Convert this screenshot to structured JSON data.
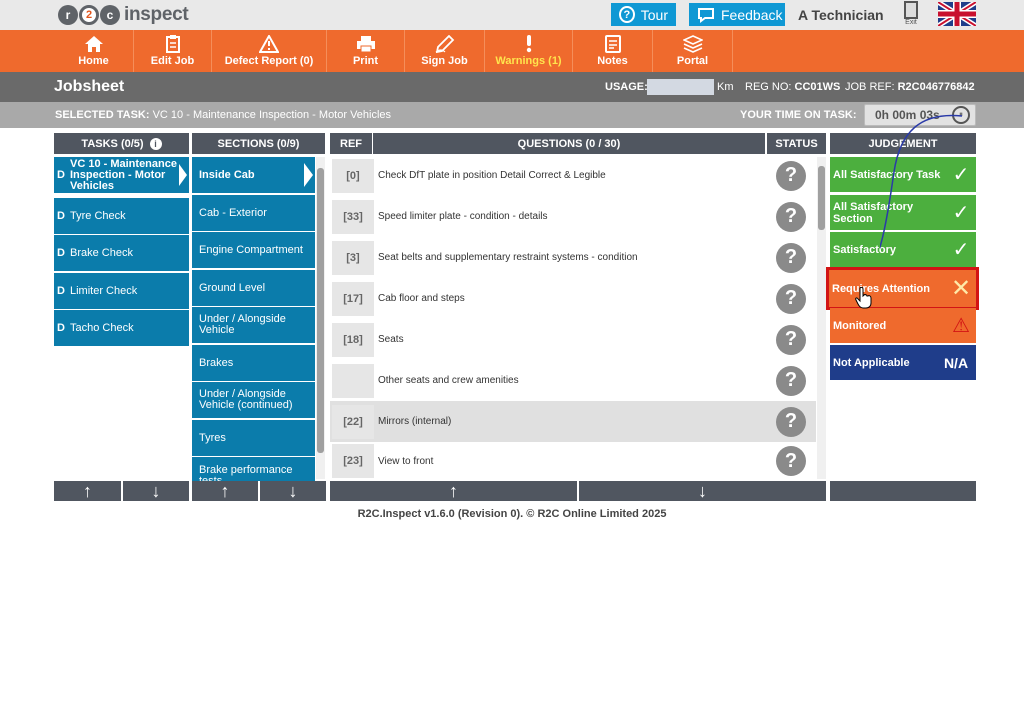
{
  "topbar": {
    "logo_text": "inspect",
    "logo_letters": [
      "r",
      "2",
      "c"
    ],
    "tour_label": "Tour",
    "feedback_label": "Feedback",
    "user_name": "A Technician",
    "exit_label": "Exit",
    "language_flag": "uk-flag-icon"
  },
  "toolbar": {
    "items": [
      {
        "label": "Home",
        "icon": "home-icon"
      },
      {
        "label": "Edit Job",
        "icon": "clipboard-icon"
      },
      {
        "label": "Defect Report (0)",
        "icon": "warning-triangle-icon"
      },
      {
        "label": "Print",
        "icon": "printer-icon"
      },
      {
        "label": "Sign Job",
        "icon": "pen-icon"
      },
      {
        "label": "Warnings (1)",
        "icon": "exclamation-icon"
      },
      {
        "label": "Notes",
        "icon": "notes-icon"
      },
      {
        "label": "Portal",
        "icon": "portal-icon"
      }
    ]
  },
  "jobsheet": {
    "title": "Jobsheet",
    "usage_label": "USAGE:",
    "usage_value": "",
    "usage_unit": "Km",
    "reg_label": "REG NO:",
    "reg_value": "CC01WS",
    "job_ref_label": "JOB REF:",
    "job_ref_value": "R2C046776842"
  },
  "selected_task": {
    "label": "SELECTED TASK:",
    "value": "VC 10 - Maintenance Inspection - Motor Vehicles",
    "time_label": "YOUR TIME ON TASK:",
    "time_value": "0h 00m 03s"
  },
  "columns": {
    "tasks": "TASKS (0/5)",
    "sections": "SECTIONS (0/9)",
    "ref": "REF",
    "questions": "QUESTIONS (0 / 30)",
    "status": "STATUS",
    "judgement": "JUDGEMENT"
  },
  "tasks": [
    {
      "prefix": "D",
      "label": "VC 10 - Maintenance Inspection - Motor Vehicles",
      "active": true
    },
    {
      "prefix": "D",
      "label": "Tyre Check"
    },
    {
      "prefix": "D",
      "label": "Brake Check"
    },
    {
      "prefix": "D",
      "label": "Limiter Check"
    },
    {
      "prefix": "D",
      "label": "Tacho Check"
    }
  ],
  "sections": [
    {
      "label": "Inside Cab",
      "active": true
    },
    {
      "label": "Cab - Exterior"
    },
    {
      "label": "Engine Compartment"
    },
    {
      "label": "Ground Level"
    },
    {
      "label": "Under / Alongside Vehicle"
    },
    {
      "label": "Brakes"
    },
    {
      "label": "Under / Alongside Vehicle (continued)"
    },
    {
      "label": "Tyres"
    },
    {
      "label": "Brake performance tests"
    }
  ],
  "questions": [
    {
      "ref": "[0]",
      "text": "Check DfT plate in position Detail Correct & Legible",
      "status": "?"
    },
    {
      "ref": "[33]",
      "text": "Speed limiter plate - condition - details",
      "status": "?"
    },
    {
      "ref": "[3]",
      "text": "Seat belts and supplementary restraint systems - condition",
      "status": "?"
    },
    {
      "ref": "[17]",
      "text": "Cab floor and steps",
      "status": "?"
    },
    {
      "ref": "[18]",
      "text": "Seats",
      "status": "?"
    },
    {
      "ref": "",
      "text": "Other seats and crew amenities",
      "status": "?"
    },
    {
      "ref": "[22]",
      "text": "Mirrors (internal)",
      "status": "?",
      "highlight": true
    },
    {
      "ref": "[23]",
      "text": "View to front",
      "status": "?"
    }
  ],
  "judgement": [
    {
      "label": "All Satisfactory Task",
      "mark": "✓",
      "color": "#4caf3e"
    },
    {
      "label": "All Satisfactory Section",
      "mark": "✓",
      "color": "#4caf3e"
    },
    {
      "label": "Satisfactory",
      "mark": "✓",
      "color": "#4caf3e"
    },
    {
      "label": "Requires Attention",
      "mark": "✕",
      "color": "#ef6a2d"
    },
    {
      "label": "Monitored",
      "mark": "⚠",
      "color": "#ef6a2d"
    },
    {
      "label": "Not Applicable",
      "mark": "N/A",
      "color": "#1f3d8a"
    }
  ],
  "footer": {
    "up_arrow": "↑",
    "down_arrow": "↓",
    "version": "R2C.Inspect v1.6.0 (Revision 0). © R2C Online Limited 2025"
  },
  "colors": {
    "orange": "#ef6a2d",
    "blue": "#0b7cab",
    "green": "#4caf3e",
    "navy": "#1f3d8a",
    "accent_blue": "#0f98d4"
  }
}
